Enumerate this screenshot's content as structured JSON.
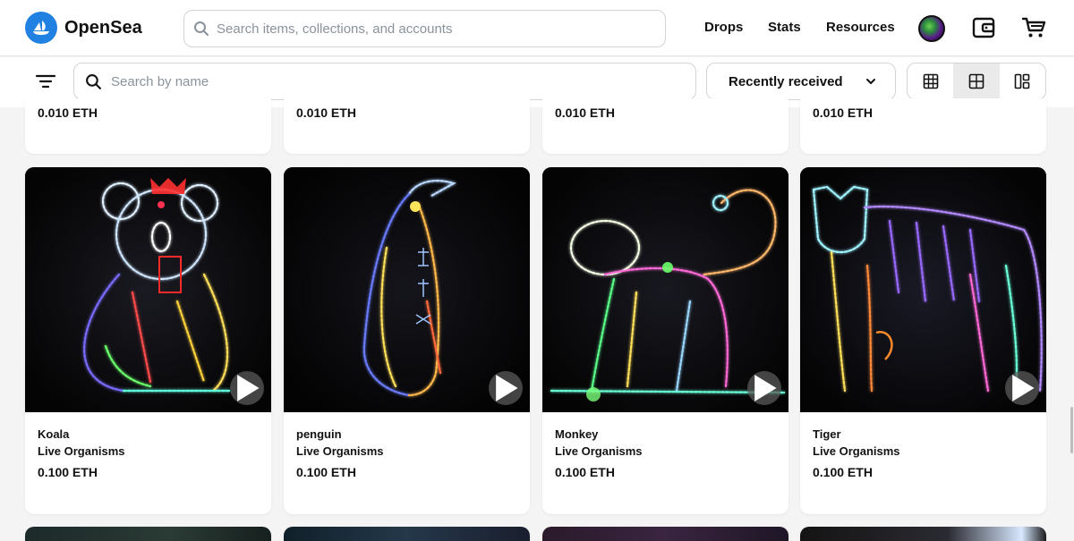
{
  "header": {
    "brand": "OpenSea",
    "search_placeholder": "Search items, collections, and accounts",
    "nav": {
      "drops": "Drops",
      "stats": "Stats",
      "resources": "Resources"
    }
  },
  "toolbar": {
    "name_search_placeholder": "Search by name",
    "sort_label": "Recently received"
  },
  "top_row": [
    {
      "price": "0.010 ETH"
    },
    {
      "price": "0.010 ETH"
    },
    {
      "price": "0.010 ETH"
    },
    {
      "price": "0.010 ETH"
    }
  ],
  "items": [
    {
      "name": "Koala",
      "collection": "Live Organisms",
      "price": "0.100 ETH"
    },
    {
      "name": "penguin",
      "collection": "Live Organisms",
      "price": "0.100 ETH"
    },
    {
      "name": "Monkey",
      "collection": "Live Organisms",
      "price": "0.100 ETH"
    },
    {
      "name": "Tiger",
      "collection": "Live Organisms",
      "price": "0.100 ETH"
    }
  ],
  "colors": {
    "brand": "#2081e2",
    "background": "#f4f4f4",
    "card": "#ffffff",
    "media": "#050505"
  },
  "icons": [
    "opensea-logo-icon",
    "search-icon",
    "avatar",
    "wallet-icon",
    "cart-icon",
    "filter-icon",
    "chevron-down-icon",
    "grid-large-icon",
    "grid-medium-icon",
    "grid-masonry-icon",
    "play-icon"
  ]
}
